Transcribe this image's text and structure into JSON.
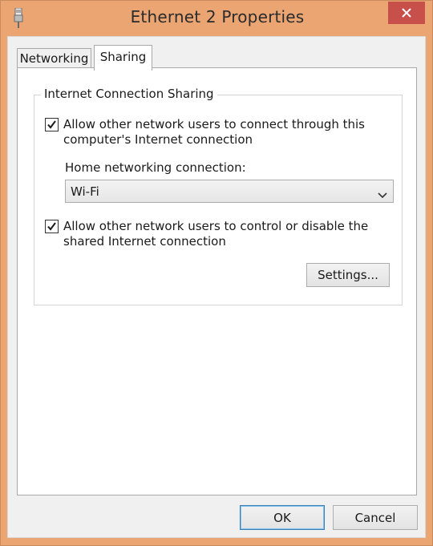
{
  "window": {
    "title": "Ethernet 2 Properties",
    "app_icon": "network-adapter-icon",
    "close_icon": "close-icon"
  },
  "tabs": [
    {
      "label": "Networking",
      "selected": false
    },
    {
      "label": "Sharing",
      "selected": true
    }
  ],
  "sharing": {
    "group_title": "Internet Connection Sharing",
    "allow_connect": {
      "checked": true,
      "line1": "Allow other network users to connect through this",
      "line2": "computer's Internet connection"
    },
    "home_networking_label": "Home networking connection:",
    "home_networking_value": "Wi-Fi",
    "dropdown_icon": "chevron-down-icon",
    "allow_control": {
      "checked": true,
      "line1": "Allow other network users to control or disable the",
      "line2": "shared Internet connection"
    },
    "settings_label": "Settings..."
  },
  "footer": {
    "ok_label": "OK",
    "cancel_label": "Cancel"
  },
  "colors": {
    "frame": "#eaa573",
    "close_button": "#c7504b",
    "ok_border": "#3c7fb1"
  }
}
